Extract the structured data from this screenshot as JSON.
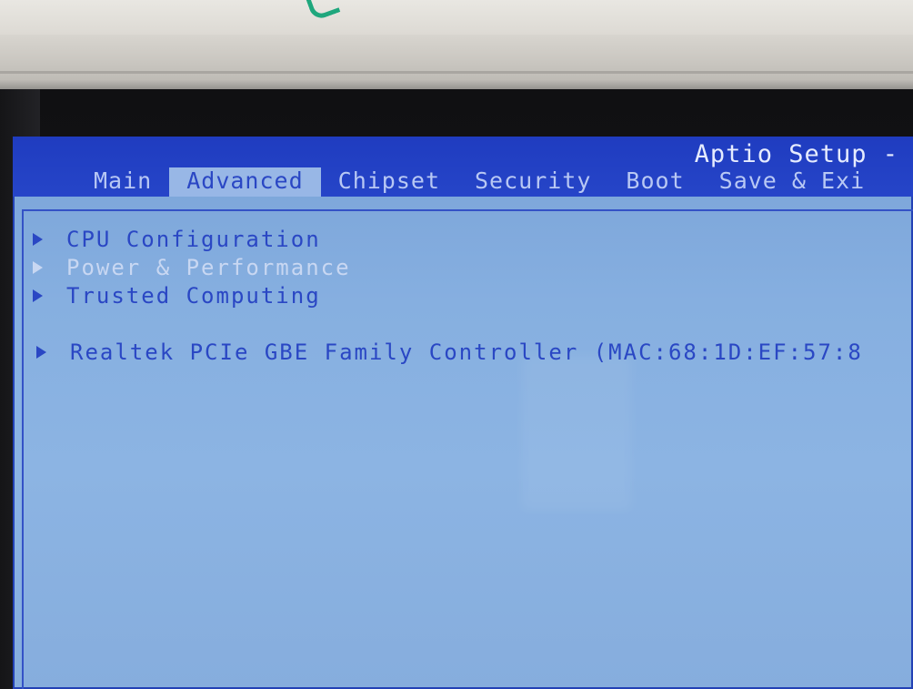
{
  "bios": {
    "title": "Aptio Setup -",
    "tabs": [
      {
        "label": "Main",
        "active": false
      },
      {
        "label": "Advanced",
        "active": true
      },
      {
        "label": "Chipset",
        "active": false
      },
      {
        "label": "Security",
        "active": false
      },
      {
        "label": "Boot",
        "active": false
      },
      {
        "label": "Save & Exi",
        "active": false
      }
    ],
    "menu_items": [
      {
        "label": "CPU Configuration",
        "icon": "submenu-arrow-icon"
      },
      {
        "label": "Power & Performance",
        "icon": "submenu-arrow-icon"
      },
      {
        "label": "Trusted Computing",
        "icon": "submenu-arrow-icon"
      },
      {
        "label": "Realtek PCIe GBE Family Controller (MAC:68:1D:EF:57:8",
        "icon": "submenu-arrow-icon"
      }
    ]
  },
  "colors": {
    "topbar": "#2645c8",
    "screen_bg": "#8cb4e3",
    "menu_text": "#2a47c4",
    "highlight_text": "#c8d7f2",
    "active_tab_bg": "#98b7e6"
  }
}
